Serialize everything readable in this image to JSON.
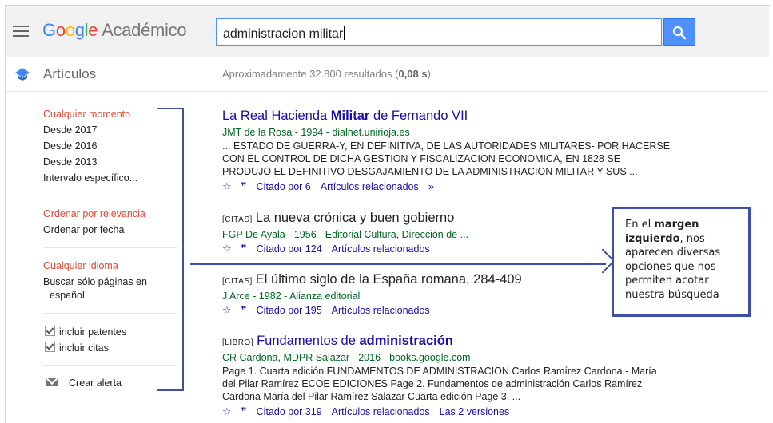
{
  "header": {
    "logo_google": [
      "G",
      "o",
      "o",
      "g",
      "l",
      "e"
    ],
    "logo_academico": "Académico",
    "search_value": "administracion militar"
  },
  "subbar": {
    "section_label": "Artículos",
    "results_prefix": "Aproximadamente 32.800 resultados (",
    "results_time": "0,08 s",
    "results_suffix": ")"
  },
  "sidebar": {
    "time_filters": [
      "Cualquier momento",
      "Desde 2017",
      "Desde 2016",
      "Desde 2013",
      "Intervalo específico..."
    ],
    "sort_options": [
      "Ordenar por relevancia",
      "Ordenar por fecha"
    ],
    "language_options": [
      "Cualquier idioma",
      "Buscar sólo páginas en",
      "español"
    ],
    "checkboxes": [
      "incluir patentes",
      "incluir citas"
    ],
    "create_alert": "Crear alerta"
  },
  "results": [
    {
      "title_a": "La Real Hacienda ",
      "title_b": "Militar",
      "title_c": " de Fernando VII",
      "meta": "JMT de la Rosa - 1994 - dialnet.unirioja.es",
      "snippet_lines": [
        "... ESTADO DE GUERRA-Y, EN DEFINITIVA, DE LAS AUTORIDADES MILITARES- POR HACERSE",
        "CON EL CONTROL DE DICHA GESTION Y FISCALIZACION ECONOMICA, EN 1828 SE",
        "PRODUJO EL DEFINITIVO DESGAJAMIENTO DE LA ADMINISTRACION MILITAR Y SUS ..."
      ],
      "cited": "Citado por 6",
      "related": "Artículos relacionados"
    },
    {
      "tag": "[CITAS]",
      "title": "La nueva crónica y buen gobierno",
      "meta": "FGP De Ayala - 1956 - Editorial Cultura, Dirección de ...",
      "cited": "Citado por 124",
      "related": "Artículos relacionados"
    },
    {
      "tag": "[CITAS]",
      "title": "El último siglo de la España romana, 284-409",
      "meta": "J Arce - 1982 - Alianza editorial",
      "cited": "Citado por 195",
      "related": "Artículos relacionados"
    },
    {
      "tag": "[LIBRO]",
      "title_a": "Fundamentos de ",
      "title_b": "administración",
      "meta_a": "CR Cardona, ",
      "meta_link": "MDPR Salazar",
      "meta_b": " - 2016 - books.google.com",
      "snippet_lines": [
        "Page 1. Cuarta edición FUNDAMENTOS DE ADMINISTRACION Carlos Ramírez Cardona - María",
        "del Pilar Ramírez ECOE EDICIONES Page 2. Fundamentos de administración Carlos Ramírez",
        "Cardona María del Pilar Ramírez Salazar Cuarta edición Page 3. ..."
      ],
      "cited": "Citado por 319",
      "related": "Artículos relacionados",
      "versions": "Las 2 versiones"
    }
  ],
  "callout": {
    "text_a": "En el ",
    "text_bold": "margen izquierdo",
    "text_b": ", nos aparecen diversas opciones que nos permiten acotar nuestra búsqueda"
  },
  "colors": {
    "accent": "#4d90fe",
    "annotation": "#3f4fa8",
    "link": "#1a0dab",
    "meta": "#006621",
    "filter_active": "#dd4b39"
  },
  "icons": {
    "star": "star-icon",
    "quote": "quote-icon",
    "menu": "hamburger-menu-icon",
    "search": "search-icon",
    "mail": "mail-icon"
  }
}
